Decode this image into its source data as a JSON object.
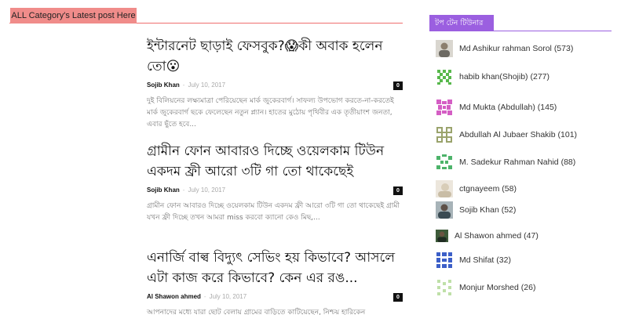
{
  "left_section": {
    "tab_label": "ALL Category's Latest post Here"
  },
  "posts": [
    {
      "title": "ইন্টারনেট ছাড়াই ফেসবুক?😱কী অবাক হলেন তো😮",
      "author": "Sojib Khan",
      "date": "July 10, 2017",
      "comments": "0",
      "excerpt": "দুই বিলিয়নের লক্ষ্যমাত্রা পেরিয়েছেন মার্ক জুকেরবার্গ। সাফল্য উপভোগ করতে-না-করতেই মার্ক জুকেরবার্গ ছকে ফেলেছেন নতুন প্ল্যান। হাতের মুঠোয় পৃথিবীর এক তৃতীয়াংশ জনতা, এবার ছুঁতে হবে..."
    },
    {
      "title": "গ্রামীন ফোন আবারও দিচ্ছে ওয়েলকাম টিউন একদম ফ্রী আরো ৩টি গা তো থাকেছেই",
      "author": "Sojib Khan",
      "date": "July 10, 2017",
      "comments": "0",
      "excerpt": "গ্রামীন ফোন আবারও দিচ্ছে ওয়েলকাম টিউন একদম ফ্রী আরো ৩টি গা তো থাকেছেই গ্রামী যখন ফ্রী দিচ্ছে তখন আমরা miss করবো ক্যানো কেও মিছ,..."
    },
    {
      "title": "এনার্জি বাল্ব বিদ্যুৎ সেভিং হয় কিভাবে? আসলে এটা কাজ করে কিভাবে? কেন এর রঙ...",
      "author": "Al Shawon ahmed",
      "date": "July 10, 2017",
      "comments": "0",
      "excerpt": "আপনাদের মধ্যে যারা ছোট বেলায় গ্রামের বাড়িতে কাটিয়েছেন, নিশ্চয় হারিকেন"
    }
  ],
  "sidebar": {
    "title": "টপ টেন টিউনার",
    "accent_color": "#9b5fe0",
    "tuners": [
      {
        "name": "Md Ashikur rahman Sorol",
        "count": "(573)",
        "avatar": "photo-avatar"
      },
      {
        "name": "habib khan(Shojib)",
        "count": "(277)",
        "avatar": "identicon-green"
      },
      {
        "name": "Md Mukta (Abdullah)",
        "count": "(145)",
        "avatar": "identicon-pink"
      },
      {
        "name": "Abdullah Al Jubaer Shakib",
        "count": "(101)",
        "avatar": "identicon-olive"
      },
      {
        "name": "M. Sadekur Rahman Nahid",
        "count": "(88)",
        "avatar": "identicon-green2"
      },
      {
        "name": "ctgnayeem",
        "count": "(58)",
        "avatar": "photo-avatar"
      },
      {
        "name": "Sojib Khan",
        "count": "(52)",
        "avatar": "photo-avatar"
      },
      {
        "name": "Al Shawon ahmed",
        "count": "(47)",
        "avatar": "photo-avatar"
      },
      {
        "name": "Md Shifat",
        "count": "(32)",
        "avatar": "identicon-blue"
      },
      {
        "name": "Monjur Morshed",
        "count": "(26)",
        "avatar": "identicon-lightgreen"
      }
    ]
  }
}
